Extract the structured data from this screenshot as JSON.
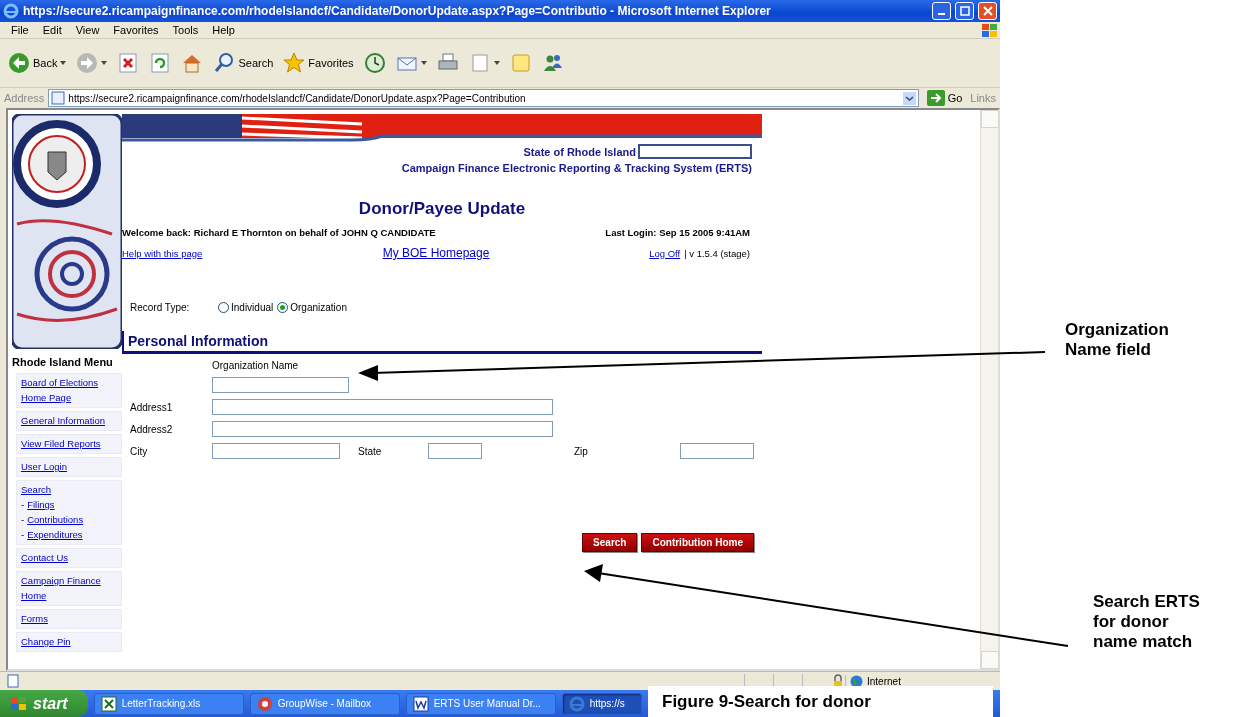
{
  "window": {
    "title": "https://secure2.ricampaignfinance.com/rhodeIslandcf/Candidate/DonorUpdate.aspx?Page=Contributio - Microsoft Internet Explorer"
  },
  "menu": [
    "File",
    "Edit",
    "View",
    "Favorites",
    "Tools",
    "Help"
  ],
  "toolbar": [
    {
      "kind": "back",
      "label": "Back",
      "dropdown": true
    },
    {
      "kind": "forward",
      "dropdown": true
    },
    {
      "kind": "stop"
    },
    {
      "kind": "refresh"
    },
    {
      "kind": "home"
    },
    {
      "kind": "search",
      "label": "Search"
    },
    {
      "kind": "favorites",
      "label": "Favorites"
    },
    {
      "kind": "history"
    },
    {
      "kind": "mail",
      "dropdown": true
    },
    {
      "kind": "print"
    },
    {
      "kind": "edit",
      "dropdown": true
    },
    {
      "kind": "note"
    },
    {
      "kind": "messenger"
    }
  ],
  "address": {
    "label": "Address",
    "value": "https://secure2.ricampaignfinance.com/rhodeIslandcf/Candidate/DonorUpdate.aspx?Page=Contribution",
    "go": "Go",
    "links": "Links"
  },
  "page": {
    "state_title": "State of Rhode Island",
    "system_title": "Campaign Finance Electronic Reporting & Tracking System (ERTS)",
    "heading": "Donor/Payee Update",
    "welcome": "Welcome back: Richard E Thornton on behalf of JOHN Q CANDIDATE",
    "last_login": "Last Login: Sep 15 2005 9:41AM",
    "help_link": "Help with this page",
    "home_link": "My BOE Homepage",
    "logoff_link": "Log Off",
    "version": "| v 1.5.4 (stage)"
  },
  "sidebar": {
    "title": "Rhode Island Menu",
    "groups": [
      [
        {
          "label": "Board of Elections Home Page"
        }
      ],
      [
        {
          "label": "General Information"
        }
      ],
      [
        {
          "label": "View Filed Reports"
        }
      ],
      [
        {
          "label": "User Login"
        }
      ],
      [
        {
          "label": "Search"
        },
        {
          "prefix": "-",
          "label": "Filings"
        },
        {
          "prefix": "-",
          "label": "Contributions"
        },
        {
          "prefix": "-",
          "label": "Expenditures"
        }
      ],
      [
        {
          "label": "Contact Us"
        }
      ],
      [
        {
          "label": "Campaign Finance Home"
        }
      ],
      [
        {
          "label": "Forms"
        }
      ],
      [
        {
          "label": "Change Pin"
        }
      ]
    ]
  },
  "form": {
    "record_type": {
      "label": "Record Type:",
      "options": [
        {
          "label": "Individual",
          "selected": false
        },
        {
          "label": "Organization",
          "selected": true
        }
      ]
    },
    "section": "Personal Information",
    "org_name_label": "Organization Name",
    "address_fields": [
      {
        "label": "Address1"
      },
      {
        "label": "Address2"
      }
    ],
    "location_fields": [
      {
        "label": "City"
      },
      {
        "label": "State"
      },
      {
        "label": "Zip"
      }
    ],
    "buttons": [
      "Search",
      "Contribution Home"
    ]
  },
  "status_bar": {
    "zone": "Internet"
  },
  "taskbar": {
    "start": "start",
    "items": [
      {
        "kind": "excel",
        "label": "LetterTracking.xls",
        "selected": false
      },
      {
        "kind": "groupwise",
        "label": "GroupWise - Mailbox",
        "selected": false
      },
      {
        "kind": "word",
        "label": "ERTS User Manual Dr...",
        "selected": false
      },
      {
        "kind": "ie",
        "label": "https://s",
        "selected": true
      }
    ]
  },
  "annotations": [
    {
      "lines": [
        "Organization",
        "Name field"
      ]
    },
    {
      "lines": [
        "Search ERTS",
        "for donor",
        "name match"
      ]
    }
  ],
  "caption": "Figure 9-Search for donor"
}
